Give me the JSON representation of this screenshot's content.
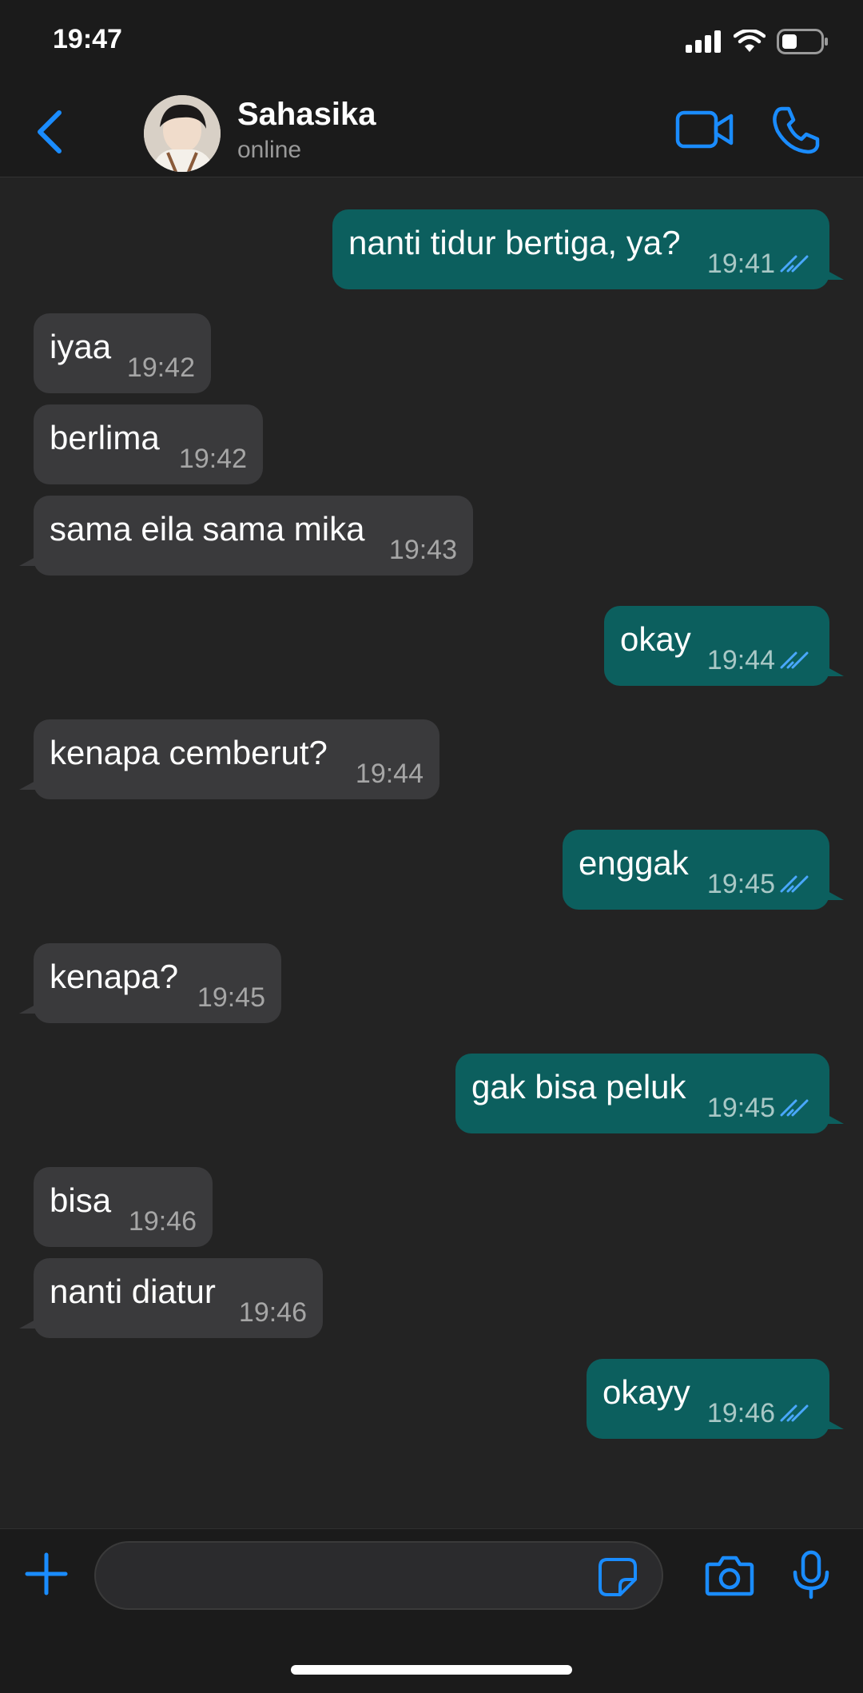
{
  "status_bar": {
    "time": "19:47",
    "icons": [
      "signal-icon",
      "wifi-icon",
      "battery-icon"
    ]
  },
  "header": {
    "contact_name": "Sahasika",
    "contact_status": "online",
    "icons": [
      "back-chevron-icon",
      "video-call-icon",
      "phone-call-icon"
    ]
  },
  "colors": {
    "accent": "#1a8cff",
    "incoming_bubble": "#3a3a3c",
    "outgoing_bubble": "#0c5f5e",
    "background": "#232323",
    "read_ticks": "#4aa8ff"
  },
  "messages": [
    {
      "direction": "out",
      "text": "nanti tidur bertiga, ya?",
      "time": "19:41",
      "read": true
    },
    {
      "direction": "in",
      "text": "iyaa",
      "time": "19:42"
    },
    {
      "direction": "in",
      "text": "berlima",
      "time": "19:42"
    },
    {
      "direction": "in",
      "text": "sama eila sama mika",
      "time": "19:43"
    },
    {
      "direction": "out",
      "text": "okay",
      "time": "19:44",
      "read": true
    },
    {
      "direction": "in",
      "text": "kenapa cemberut?",
      "time": "19:44"
    },
    {
      "direction": "out",
      "text": "enggak",
      "time": "19:45",
      "read": true
    },
    {
      "direction": "in",
      "text": "kenapa?",
      "time": "19:45"
    },
    {
      "direction": "out",
      "text": "gak bisa peluk",
      "time": "19:45",
      "read": true
    },
    {
      "direction": "in",
      "text": "bisa",
      "time": "19:46"
    },
    {
      "direction": "in",
      "text": "nanti diatur",
      "time": "19:46"
    },
    {
      "direction": "out",
      "text": "okayy",
      "time": "19:46",
      "read": true
    }
  ],
  "input_bar": {
    "message_placeholder": "",
    "icons": [
      "plus-icon",
      "sticker-icon",
      "camera-icon",
      "microphone-icon"
    ]
  }
}
